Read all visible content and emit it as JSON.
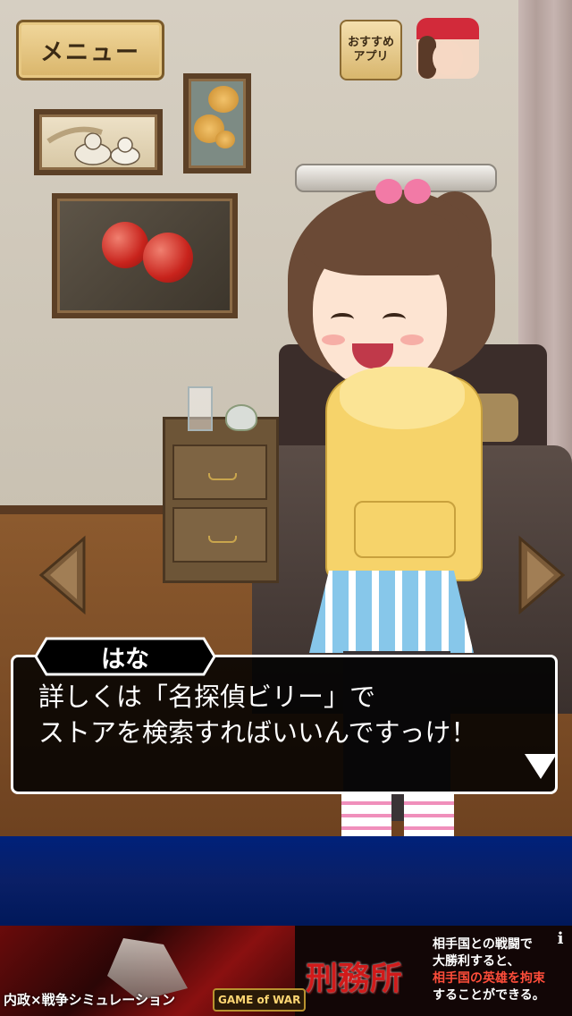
{
  "header": {
    "menu_label": "メニュー",
    "recommend_label": "おすすめ\nアプリ"
  },
  "dialog": {
    "speaker": "はな",
    "text": "詳しくは「名探偵ビリー」で\nストアを検索すればいいんですっけ！"
  },
  "navigation": {
    "left_icon": "left-arrow-icon",
    "right_icon": "right-arrow-icon",
    "advance_icon": "advance-triangle-icon"
  },
  "ad_banner": {
    "caption": "内政×戦争シミュレーション",
    "logo_text": "GAME of WAR",
    "title": "刑務所",
    "desc_line1": "相手国との戦闘で",
    "desc_line2": "大勝利すると、",
    "desc_highlight": "相手国の英雄を拘束",
    "desc_line4": "することができる。",
    "info_icon": "i"
  },
  "colors": {
    "dialog_bg": "#000000",
    "dialog_border": "#ffffff",
    "menu_gold": "#d9b56a",
    "ad_blue": "#0a1f66",
    "banner_red": "#d11a1a"
  }
}
